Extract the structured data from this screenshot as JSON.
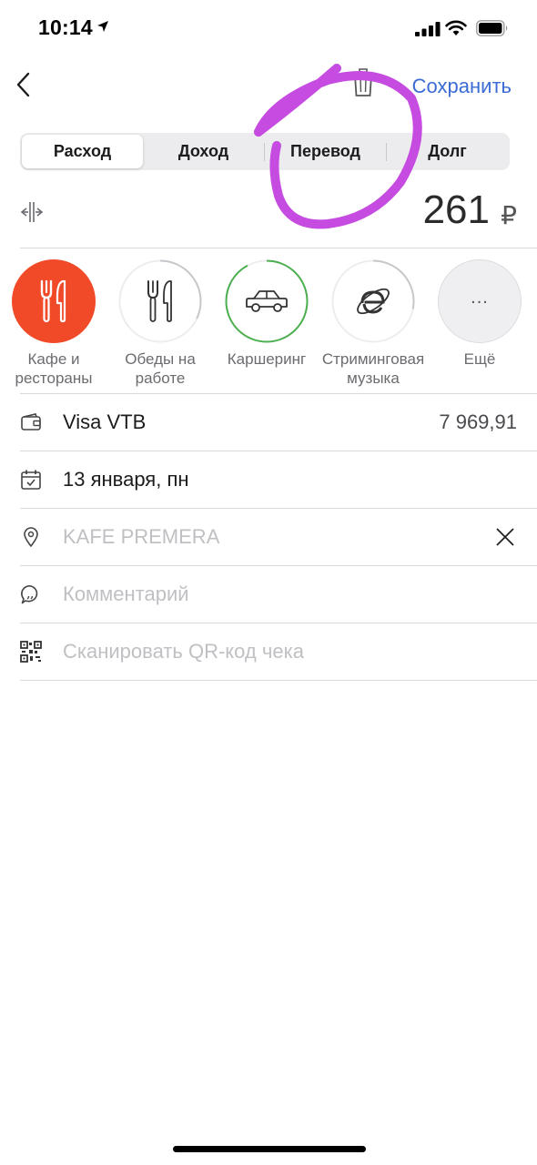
{
  "status": {
    "time": "10:14",
    "icons": [
      "location-arrow-icon",
      "cellular-signal-icon",
      "wifi-icon",
      "battery-icon"
    ]
  },
  "nav": {
    "back_icon": "chevron-left-icon",
    "trash_icon": "trash-icon",
    "save_label": "Сохранить"
  },
  "tabs": [
    {
      "label": "Расход",
      "active": true
    },
    {
      "label": "Доход",
      "active": false
    },
    {
      "label": "Перевод",
      "active": false
    },
    {
      "label": "Долг",
      "active": false
    }
  ],
  "amount": {
    "value": "261",
    "currency": "₽",
    "split_icon": "split-icon"
  },
  "categories": [
    {
      "label": "Кафе и рестораны",
      "icon": "fork-knife-icon",
      "selected": true,
      "progress": 1.0,
      "ring_color": "#f04a28"
    },
    {
      "label": "Обеды на работе",
      "icon": "fork-knife-icon",
      "selected": false,
      "progress": 0.32,
      "ring_color": "#c8c8cc"
    },
    {
      "label": "Каршеринг",
      "icon": "car-icon",
      "selected": false,
      "progress": 0.92,
      "ring_color": "#4caf50"
    },
    {
      "label": "Стриминговая музыка",
      "icon": "internet-explorer-icon",
      "selected": false,
      "progress": 0.28,
      "ring_color": "#c8c8cc"
    },
    {
      "label": "Ещё",
      "icon": "ellipsis-icon",
      "selected": false,
      "progress": 0,
      "ring_color": "#c8c8cc"
    }
  ],
  "more_dots": "...",
  "rows": {
    "account": {
      "icon": "wallet-icon",
      "label": "Visa VTB",
      "value": "7 969,91"
    },
    "date": {
      "icon": "calendar-icon",
      "label": "13 января, пн"
    },
    "place": {
      "icon": "location-pin-icon",
      "label": "KAFE PREMERA",
      "clear_icon": "close-icon"
    },
    "comment": {
      "icon": "comment-icon",
      "label": "Комментарий"
    },
    "scan": {
      "icon": "qr-code-icon",
      "label": "Сканировать QR-код чека"
    }
  },
  "colors": {
    "accent": "#3b6cd6",
    "selected_category": "#f04a28",
    "annotation": "#c64be0"
  }
}
